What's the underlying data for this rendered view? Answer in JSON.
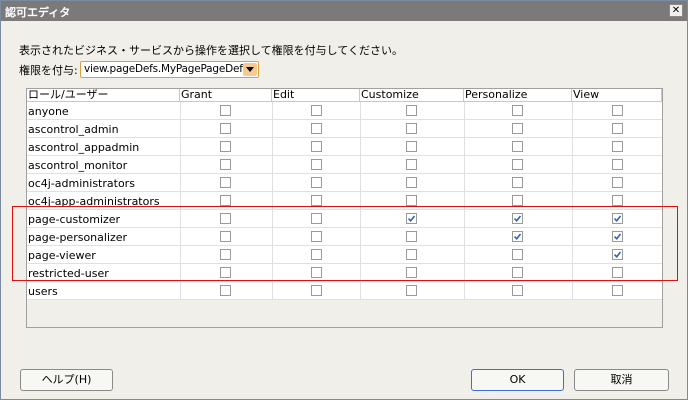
{
  "window": {
    "title": "認可エディタ",
    "close_glyph": "✕"
  },
  "instruction": "表示されたビジネス・サービスから操作を選択して権限を付与してください。",
  "grant_label": "権限を付与:",
  "grant_select": {
    "value": "view.pageDefs.MyPagePageDef"
  },
  "columns": [
    "ロール/ユーザー",
    "Grant",
    "Edit",
    "Customize",
    "Personalize",
    "View"
  ],
  "rows": [
    {
      "name": "anyone",
      "checks": [
        false,
        false,
        false,
        false,
        false
      ]
    },
    {
      "name": "ascontrol_admin",
      "checks": [
        false,
        false,
        false,
        false,
        false
      ]
    },
    {
      "name": "ascontrol_appadmin",
      "checks": [
        false,
        false,
        false,
        false,
        false
      ]
    },
    {
      "name": "ascontrol_monitor",
      "checks": [
        false,
        false,
        false,
        false,
        false
      ]
    },
    {
      "name": "oc4j-administrators",
      "checks": [
        false,
        false,
        false,
        false,
        false
      ]
    },
    {
      "name": "oc4j-app-administrators",
      "checks": [
        false,
        false,
        false,
        false,
        false
      ]
    },
    {
      "name": "page-customizer",
      "checks": [
        false,
        false,
        true,
        true,
        true
      ]
    },
    {
      "name": "page-personalizer",
      "checks": [
        false,
        false,
        false,
        true,
        true
      ]
    },
    {
      "name": "page-viewer",
      "checks": [
        false,
        false,
        false,
        false,
        true
      ]
    },
    {
      "name": "restricted-user",
      "checks": [
        false,
        false,
        false,
        false,
        false
      ]
    },
    {
      "name": "users",
      "checks": [
        false,
        false,
        false,
        false,
        false
      ]
    }
  ],
  "buttons": {
    "help": "ヘルプ(H)",
    "ok": "OK",
    "cancel": "取消"
  },
  "colors": {
    "check": "#3060c0",
    "highlight": "#e01010",
    "titlebar": "#7a7a7a"
  }
}
